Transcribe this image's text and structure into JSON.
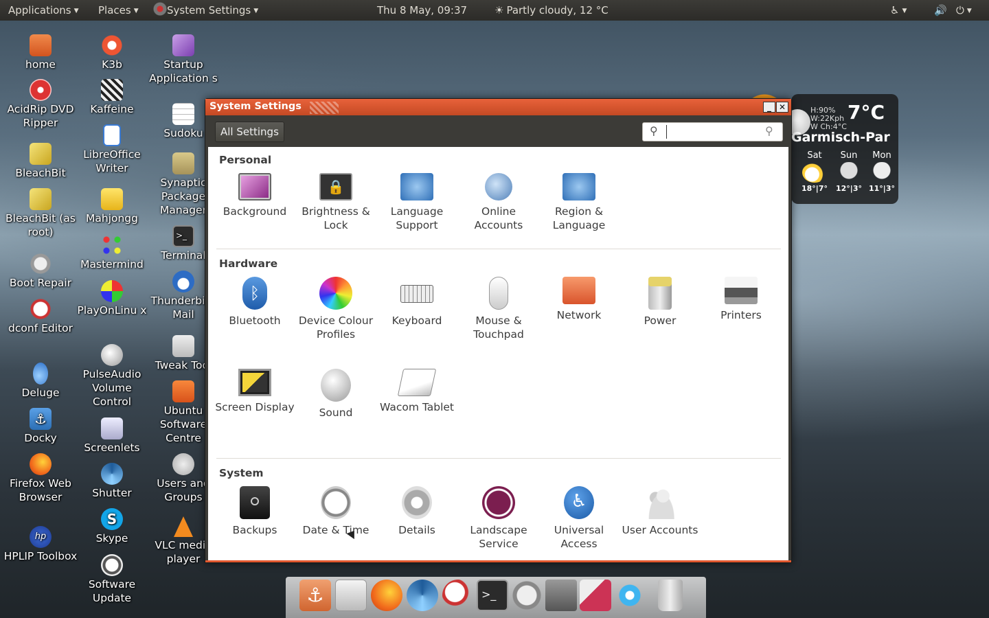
{
  "top_panel": {
    "applications": "Applications",
    "places": "Places",
    "system_settings": "System Settings",
    "clock": "Thu  8 May, 09:37",
    "weather": "Partly cloudy, 12 °C"
  },
  "desktop_icons": [
    {
      "label": "home"
    },
    {
      "label": "AcidRip DVD Ripper"
    },
    {
      "label": "BleachBit"
    },
    {
      "label": "BleachBit (as root)"
    },
    {
      "label": "Boot Repair"
    },
    {
      "label": "dconf Editor"
    },
    {
      "label": "Deluge"
    },
    {
      "label": "Docky"
    },
    {
      "label": "Firefox Web Browser"
    },
    {
      "label": "HPLIP Toolbox"
    },
    {
      "label": "K3b"
    },
    {
      "label": "Kaffeine"
    },
    {
      "label": "LibreOffice Writer"
    },
    {
      "label": "Mahjongg"
    },
    {
      "label": "Mastermind"
    },
    {
      "label": "PlayOnLinu x"
    },
    {
      "label": "PulseAudio Volume Control"
    },
    {
      "label": "Screenlets"
    },
    {
      "label": "Shutter"
    },
    {
      "label": "Skype"
    },
    {
      "label": "Software Update"
    },
    {
      "label": "Startup Application s"
    },
    {
      "label": "Sudoku"
    },
    {
      "label": "Synaptic Package Manager"
    },
    {
      "label": "Terminal"
    },
    {
      "label": "Thunderbird Mail"
    },
    {
      "label": "Tweak Tool"
    },
    {
      "label": "Ubuntu Software Centre"
    },
    {
      "label": "Users and Groups"
    },
    {
      "label": "VLC media player"
    }
  ],
  "weather_widget": {
    "stats": "H:90%\nW:22Kph\nW Ch:4°C",
    "temp": "7°C",
    "city": "Garmisch-Par",
    "days": [
      {
        "name": "Sat",
        "temps": "18°|7°"
      },
      {
        "name": "Sun",
        "temps": "12°|3°"
      },
      {
        "name": "Mon",
        "temps": "11°|3°"
      }
    ]
  },
  "window": {
    "title": "System Settings",
    "all_settings": "All Settings",
    "search_placeholder": ""
  },
  "sections": {
    "personal": {
      "title": "Personal",
      "items": [
        {
          "label": "Background",
          "icon": "monitor-icon"
        },
        {
          "label": "Brightness & Lock",
          "icon": "lock-screen-icon"
        },
        {
          "label": "Language Support",
          "icon": "globe-blue-icon"
        },
        {
          "label": "Online Accounts",
          "icon": "online-accounts-icon"
        },
        {
          "label": "Region & Language",
          "icon": "globe-blue-icon"
        }
      ]
    },
    "hardware": {
      "title": "Hardware",
      "items": [
        {
          "label": "Bluetooth",
          "icon": "bluetooth-icon"
        },
        {
          "label": "Device Colour Profiles",
          "icon": "color-flower-icon"
        },
        {
          "label": "Keyboard",
          "icon": "keyboard-icon"
        },
        {
          "label": "Mouse & Touchpad",
          "icon": "mouse-icon"
        },
        {
          "label": "Network",
          "icon": "network-folder-icon"
        },
        {
          "label": "Power",
          "icon": "power-battery-icon"
        },
        {
          "label": "Printers",
          "icon": "printer-icon"
        },
        {
          "label": "Screen Display",
          "icon": "screen-display-icon"
        },
        {
          "label": "Sound",
          "icon": "speaker-icon"
        },
        {
          "label": "Wacom Tablet",
          "icon": "tablet-icon"
        }
      ]
    },
    "system": {
      "title": "System",
      "items": [
        {
          "label": "Backups",
          "icon": "safe-icon"
        },
        {
          "label": "Date & Time",
          "icon": "clock-icon"
        },
        {
          "label": "Details",
          "icon": "gear-icon"
        },
        {
          "label": "Landscape Service",
          "icon": "landscape-icon"
        },
        {
          "label": "Universal Access",
          "icon": "accessibility-icon"
        },
        {
          "label": "User Accounts",
          "icon": "users-icon"
        }
      ]
    }
  },
  "dock": {
    "items": [
      {
        "icon": "docky-anchor-icon"
      },
      {
        "icon": "calculator-icon"
      },
      {
        "icon": "firefox-icon"
      },
      {
        "icon": "shutter-icon"
      },
      {
        "icon": "checklist-icon"
      },
      {
        "icon": "terminal-icon"
      },
      {
        "icon": "boot-repair-icon"
      },
      {
        "icon": "files-icon"
      },
      {
        "icon": "tweak-icon"
      },
      {
        "icon": "screenlets-icon"
      },
      {
        "icon": "trash-icon"
      }
    ]
  },
  "colors": {
    "accent": "#e2592f",
    "panel": "#2f2e2b",
    "landscape": "#7b1e4f"
  }
}
